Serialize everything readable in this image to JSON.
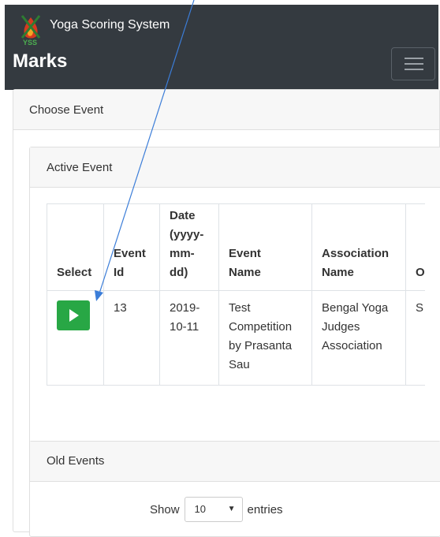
{
  "app": {
    "brand": "Yoga Scoring System",
    "page_title": "Marks"
  },
  "choose_event": {
    "title": "Choose Event"
  },
  "active_event": {
    "title": "Active Event",
    "columns": [
      "Select",
      "Event Id",
      "Date (yyyy-mm-dd)",
      "Event Name",
      "Association Name",
      "O"
    ],
    "rows": [
      {
        "event_id": "13",
        "date": "2019-10-11",
        "event_name": "Test Competition by Prasanta Sau",
        "association": "Bengal Yoga Judges Association",
        "extra": "S"
      }
    ]
  },
  "old_events": {
    "title": "Old Events",
    "show_label": "Show",
    "entries_value": "10",
    "entries_label": "entries"
  },
  "colors": {
    "navbar": "#343a40",
    "select_button": "#28a745",
    "annotation_arrow": "#3b7dd8"
  }
}
